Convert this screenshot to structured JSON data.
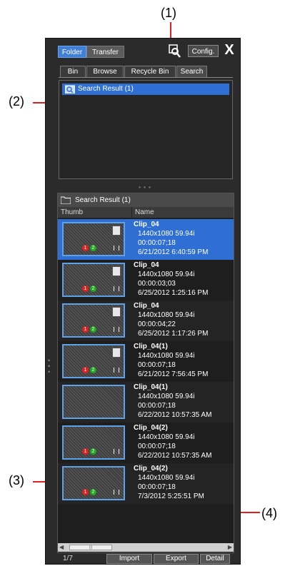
{
  "callouts": {
    "c1": "(1)",
    "c2": "(2)",
    "c3": "(3)",
    "c4": "(4)"
  },
  "topbar": {
    "folder_label": "Folder",
    "transfer_label": "Transfer",
    "config_label": "Config.",
    "close_label": "X"
  },
  "tabs": [
    "Bin",
    "Browse",
    "Recycle Bin",
    "Search"
  ],
  "tree": {
    "item_label": "Search Result (1)"
  },
  "results": {
    "header": "Search Result (1)",
    "col_thumb": "Thumb",
    "col_name": "Name",
    "rows": [
      {
        "name": "Clip_04",
        "format": "1440x1080 59.94i",
        "duration": "00:00:07;18",
        "date": "6/21/2012 6:40:59 PM"
      },
      {
        "name": "Clip_04",
        "format": "1440x1080 59.94i",
        "duration": "00:00:03;03",
        "date": "6/25/2012 1:25:16 PM"
      },
      {
        "name": "Clip_04",
        "format": "1440x1080 59.94i",
        "duration": "00:00:04;22",
        "date": "6/25/2012 1:17:26 PM"
      },
      {
        "name": "Clip_04(1)",
        "format": "1440x1080 59.94i",
        "duration": "00:00:07;18",
        "date": "6/21/2012 7:56:45 PM"
      },
      {
        "name": "Clip_04(1)",
        "format": "1440x1080 59.94i",
        "duration": "00:00:07;18",
        "date": "6/22/2012 10:57:35 AM"
      },
      {
        "name": "Clip_04(2)",
        "format": "1440x1080 59.94i",
        "duration": "00:00:07;18",
        "date": "6/22/2012 10:57:35 AM"
      },
      {
        "name": "Clip_04(2)",
        "format": "1440x1080 59.94i",
        "duration": "00:00:07;18",
        "date": "7/3/2012 5:25:51 PM"
      }
    ]
  },
  "badges": {
    "one": "1",
    "two": "2"
  },
  "footer": {
    "counter": "1/7",
    "import_label": "Import",
    "export_label": "Export",
    "detail_label": "Detail"
  },
  "colors": {
    "accent": "#2f6fd3",
    "callout_line": "#e0201c"
  }
}
